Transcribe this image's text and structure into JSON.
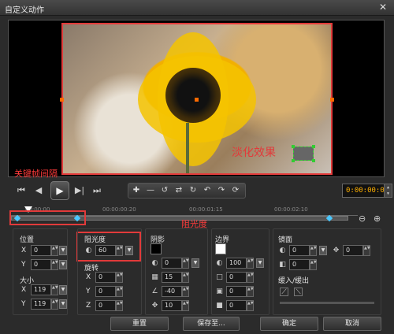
{
  "window": {
    "title": "自定义动作",
    "close_glyph": "✕"
  },
  "preview": {
    "overlay_text": "淡化效果"
  },
  "transport": {
    "start": "⏮",
    "prev": "◀",
    "play": "▶",
    "next": "▶|",
    "end": "⏭",
    "tools": [
      "✚",
      "—",
      "↺",
      "⇄",
      "↻",
      "↶",
      "↷",
      "⟳"
    ],
    "timecode": "0:00:00:03"
  },
  "timeline": {
    "ticks": [
      "00:00:00",
      "00:00:00:20",
      "00:00:01:15",
      "00:00:02:10"
    ],
    "zoom_out": "⊖",
    "zoom_in": "⊕"
  },
  "annotations": {
    "keyframe_interval": "关键帧间隔",
    "opacity": "阻光度"
  },
  "position": {
    "label": "位置",
    "x_label": "X",
    "x": "0",
    "y_label": "Y",
    "y": "0"
  },
  "size": {
    "label": "大小",
    "x_label": "X",
    "x": "119",
    "y_label": "Y",
    "y": "119"
  },
  "opacity": {
    "label": "阻光度",
    "value": "60"
  },
  "rotation": {
    "label": "旋转",
    "x_label": "X",
    "x": "0",
    "y_label": "Y",
    "y": "0",
    "z_label": "Z",
    "z": "0"
  },
  "shadow": {
    "label": "阴影",
    "color": "#000000",
    "v1": "0",
    "v2": "15",
    "v3": "-40",
    "v4": "10"
  },
  "border": {
    "label": "边界",
    "color": "#ffffff",
    "v1": "100",
    "v2": "0",
    "v3": "0",
    "v4": "0"
  },
  "mirror": {
    "label": "镜面",
    "v1": "0",
    "v2": "0",
    "v3": "0"
  },
  "ease": {
    "label": "缓入/缓出"
  },
  "footer": {
    "reset": "重置",
    "save_as": "保存至...",
    "ok": "确定",
    "cancel": "取消"
  }
}
